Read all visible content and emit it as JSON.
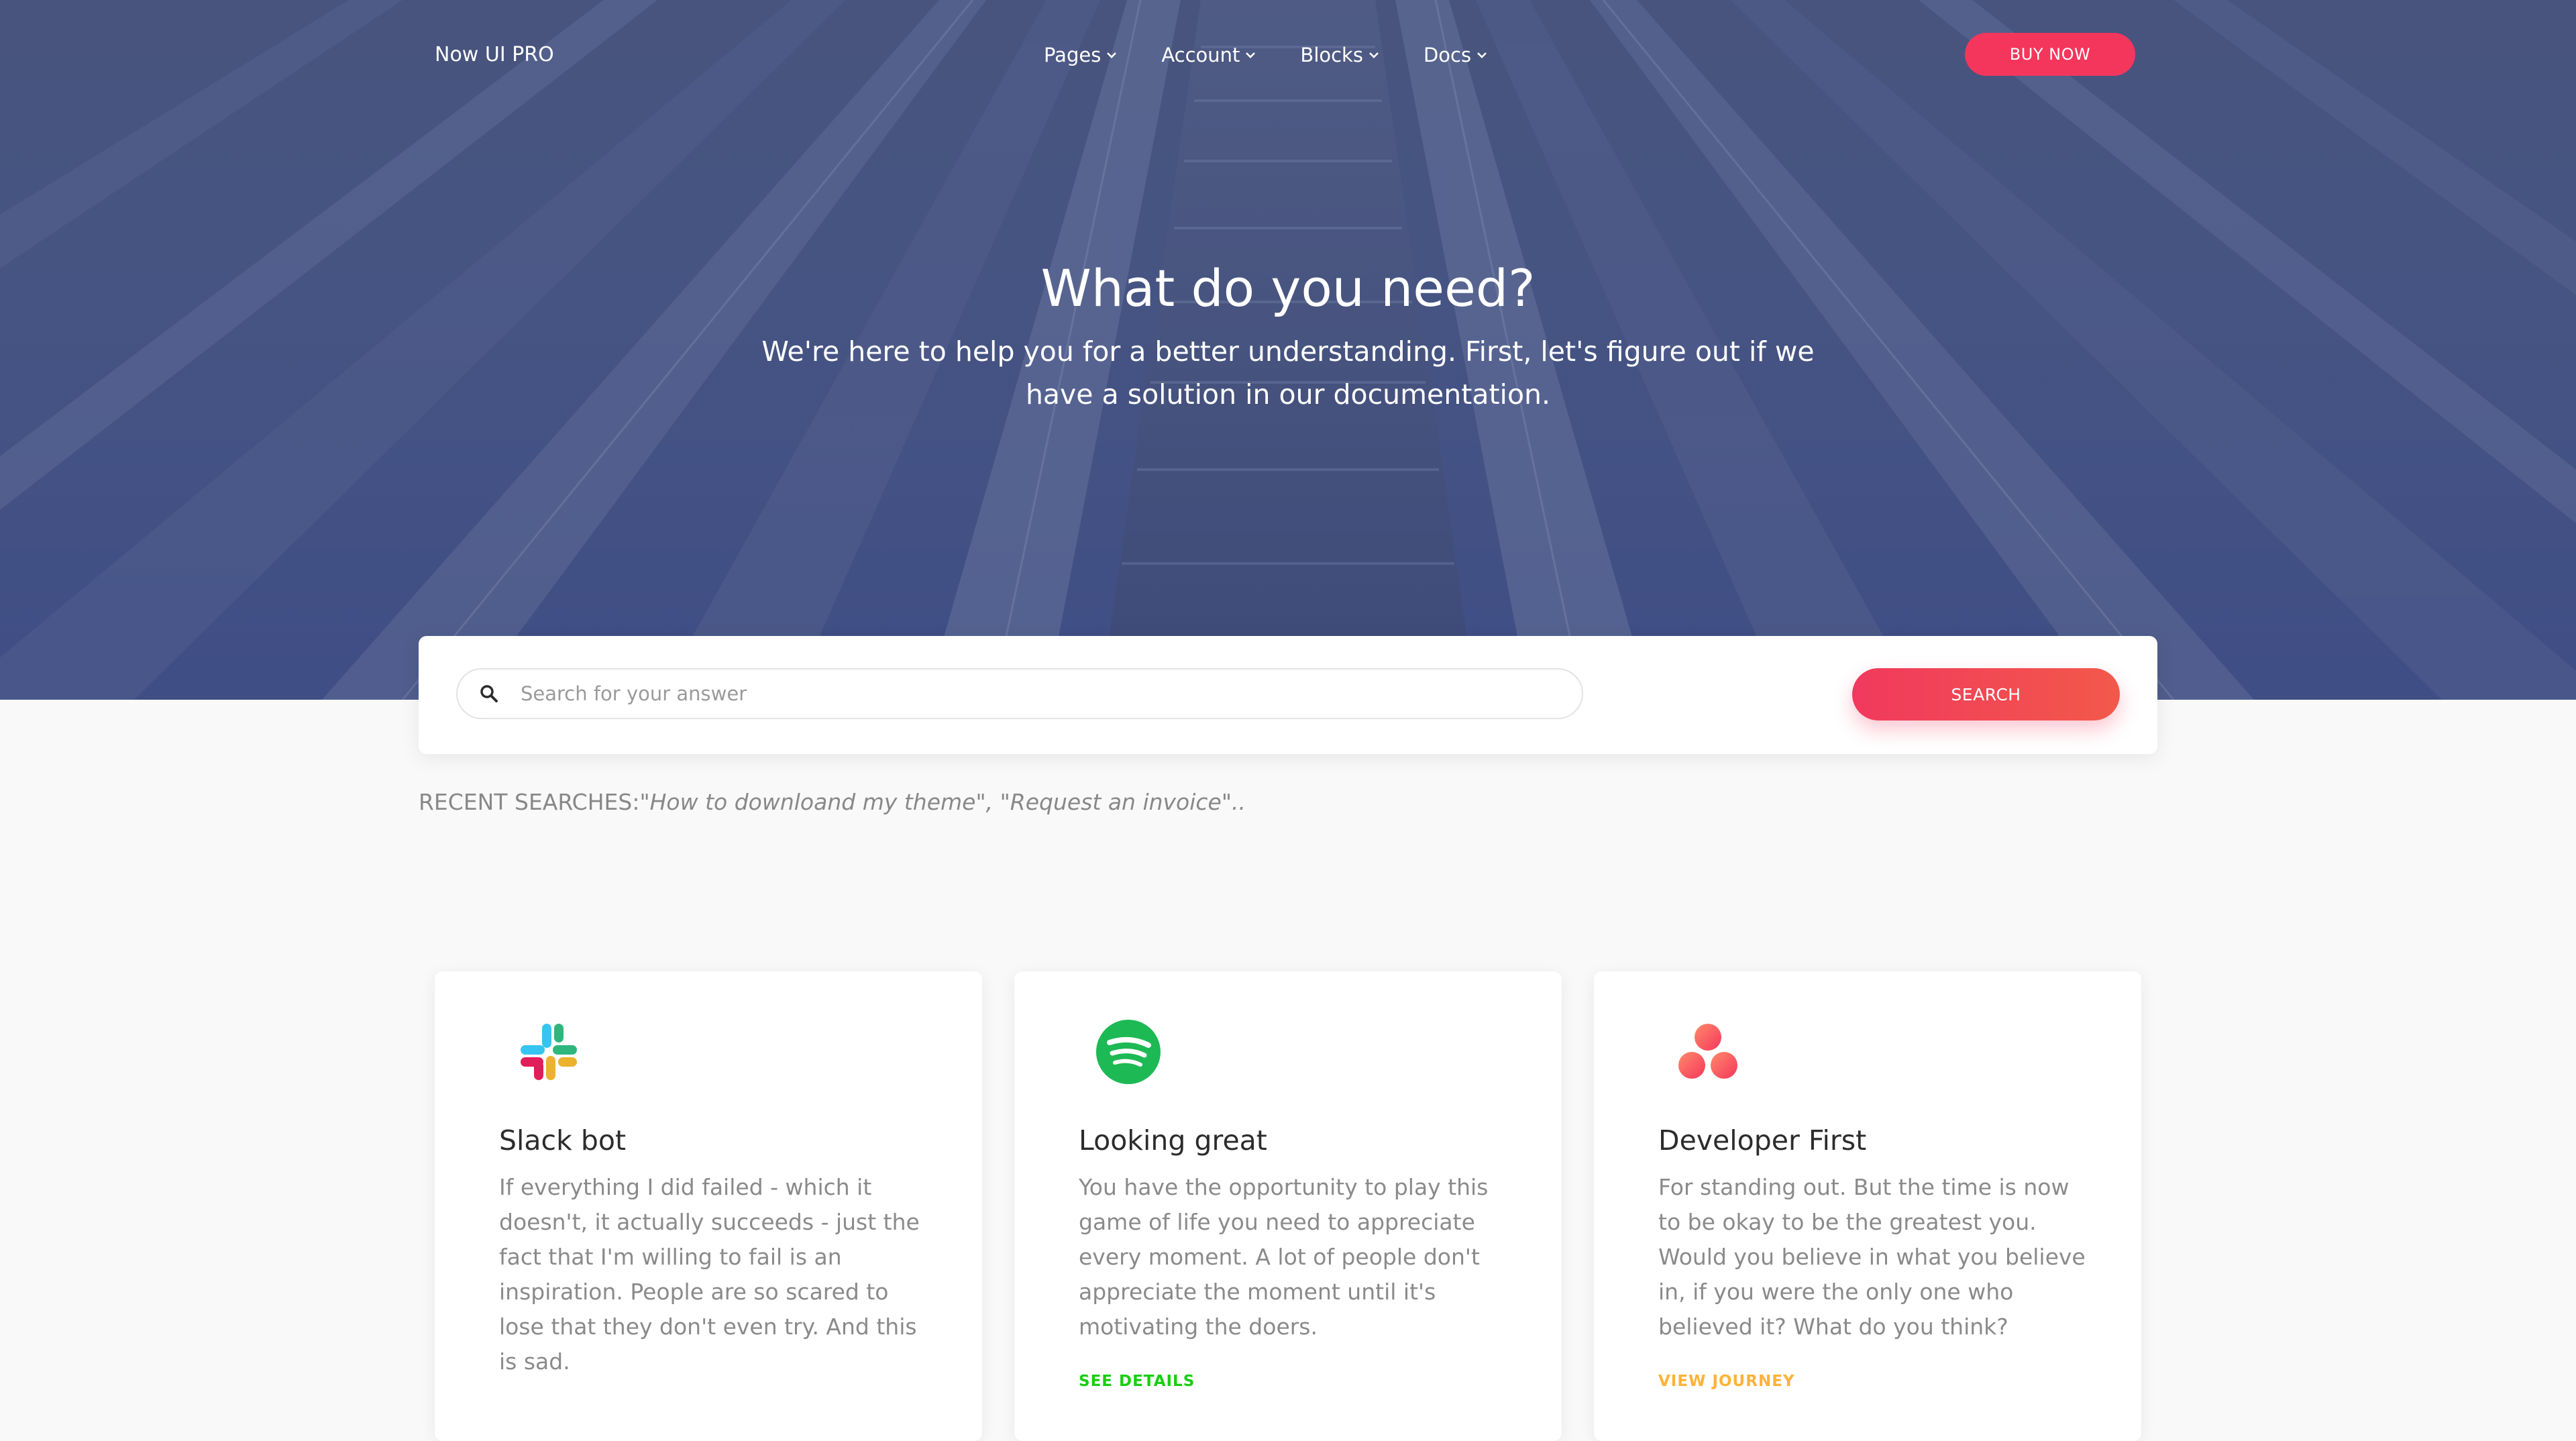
{
  "nav": {
    "brand": "Now UI PRO",
    "menu": [
      {
        "label": "Pages"
      },
      {
        "label": "Account"
      },
      {
        "label": "Blocks"
      },
      {
        "label": "Docs"
      }
    ],
    "buy_label": "BUY NOW"
  },
  "hero": {
    "title": "What do you need?",
    "subtitle": "We're here to help you for a better understanding. First, let's figure out if we have a solution in our documentation."
  },
  "search": {
    "placeholder": "Search for your answer",
    "button_label": "SEARCH"
  },
  "recent": {
    "label": "RECENT SEARCHES:",
    "queries": "\"How to downloand my theme\", \"Request an invoice\".."
  },
  "cards": [
    {
      "icon": "slack-logo-icon",
      "title": "Slack bot",
      "description": "If everything I did failed - which it doesn't, it actually succeeds - just the fact that I'm willing to fail is an inspiration. People are so scared to lose that they don't even try. And this is sad.",
      "link": ""
    },
    {
      "icon": "spotify-logo-icon",
      "title": "Looking great",
      "description": "You have the opportunity to play this game of life you need to appreciate every moment. A lot of people don't appreciate the moment until it's motivating the doers.",
      "link": "SEE DETAILS",
      "link_color": "#18ce0f"
    },
    {
      "icon": "asana-logo-icon",
      "title": "Developer First",
      "description": "For standing out. But the time is now to be okay to be the greatest you. Would you believe in what you believe in, if you were the only one who believed it? What do you think?",
      "link": "VIEW JOURNEY",
      "link_color": "#ffb236"
    }
  ],
  "colors": {
    "accent": "#f5365c",
    "hero_overlay": "#4a5682"
  }
}
